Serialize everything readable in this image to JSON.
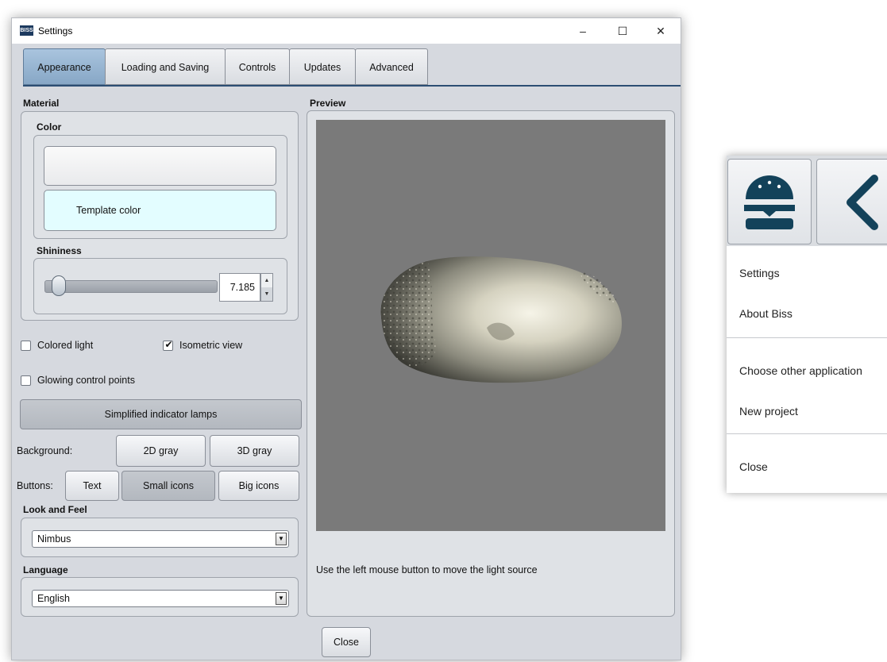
{
  "window": {
    "app_icon_text": "BISS",
    "title": "Settings",
    "controls": {
      "minimize": "–",
      "maximize": "☐",
      "close": "✕"
    }
  },
  "tabs": [
    {
      "label": "Appearance",
      "active": true
    },
    {
      "label": "Loading and Saving",
      "active": false
    },
    {
      "label": "Controls",
      "active": false
    },
    {
      "label": "Updates",
      "active": false
    },
    {
      "label": "Advanced",
      "active": false
    }
  ],
  "material": {
    "section_title": "Material",
    "color_title": "Color",
    "template_color_label": "Template color",
    "shininess_title": "Shininess",
    "shininess_value": "7.185"
  },
  "options": {
    "colored_light": {
      "label": "Colored light",
      "checked": false
    },
    "isometric_view": {
      "label": "Isometric view",
      "checked": true
    },
    "glowing_control_points": {
      "label": "Glowing control points",
      "checked": false
    },
    "simplified_indicator_lamps": "Simplified indicator lamps"
  },
  "background": {
    "label": "Background:",
    "options": [
      "2D gray",
      "3D gray"
    ]
  },
  "buttons_style": {
    "label": "Buttons:",
    "options": [
      "Text",
      "Small icons",
      "Big icons"
    ],
    "selected": "Small icons"
  },
  "look_and_feel": {
    "title": "Look and Feel",
    "value": "Nimbus"
  },
  "language": {
    "title": "Language",
    "value": "English"
  },
  "preview": {
    "title": "Preview",
    "hint": "Use the left mouse button to move the light source"
  },
  "close_button": "Close",
  "side_menu": {
    "items": [
      "Settings",
      "About Biss",
      "Choose other application",
      "New project",
      "Close"
    ]
  },
  "colors": {
    "accent": "#2c4e73",
    "active_tab": "#9ab6d3",
    "template_color": "#e3fdff",
    "icon_dark": "#13425a"
  }
}
